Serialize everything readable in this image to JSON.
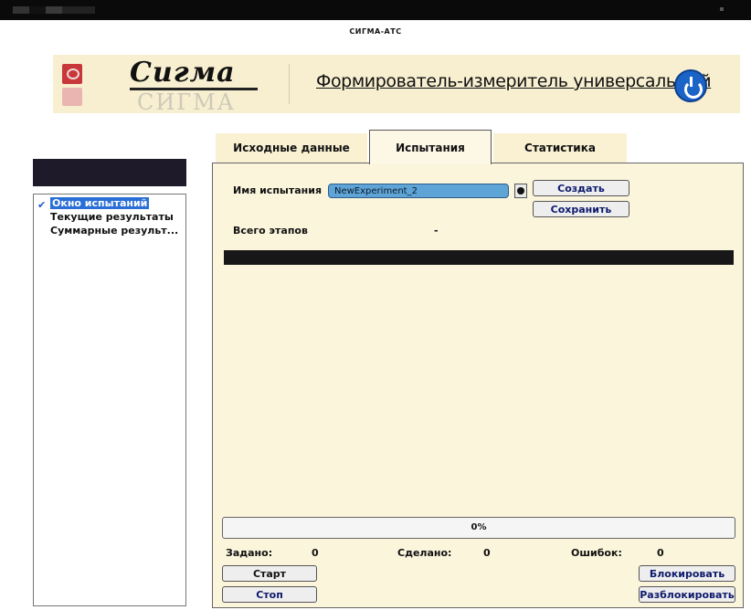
{
  "window": {
    "title": "СИГМА-АТС"
  },
  "header": {
    "logo_text": "Сигма",
    "logo_mirror": "СИГМА",
    "title": "Формирователь-измеритель универсальный"
  },
  "tabs": [
    {
      "label": "Исходные данные",
      "active": false
    },
    {
      "label": "Испытания",
      "active": true
    },
    {
      "label": "Статистика",
      "active": false
    }
  ],
  "sidebar": {
    "items": [
      {
        "label": "Окно испытаний",
        "selected": true,
        "check": "✔"
      },
      {
        "label": "Текущие результаты",
        "selected": false
      },
      {
        "label": "Суммарные результ...",
        "selected": false
      }
    ]
  },
  "experiment": {
    "name_label": "Имя испытания",
    "name_value": "NewExperiment_2",
    "create_label": "Создать",
    "save_label": "Сохранить",
    "stages_label": "Всего этапов",
    "stages_value": "-"
  },
  "progress": {
    "value": 0,
    "text": "0%"
  },
  "counters": {
    "set_label": "Задано:",
    "set_value": "0",
    "done_label": "Сделано:",
    "done_value": "0",
    "errors_label": "Ошибок:",
    "errors_value": "0"
  },
  "controls": {
    "start_label": "Старт",
    "stop_label": "Стоп",
    "block_label": "Блокировать",
    "unblock_label": "Разблокировать"
  },
  "colors": {
    "accent": "#5fa4d6",
    "panel": "#fbf5dc",
    "button_text": "#0e1a6c"
  }
}
